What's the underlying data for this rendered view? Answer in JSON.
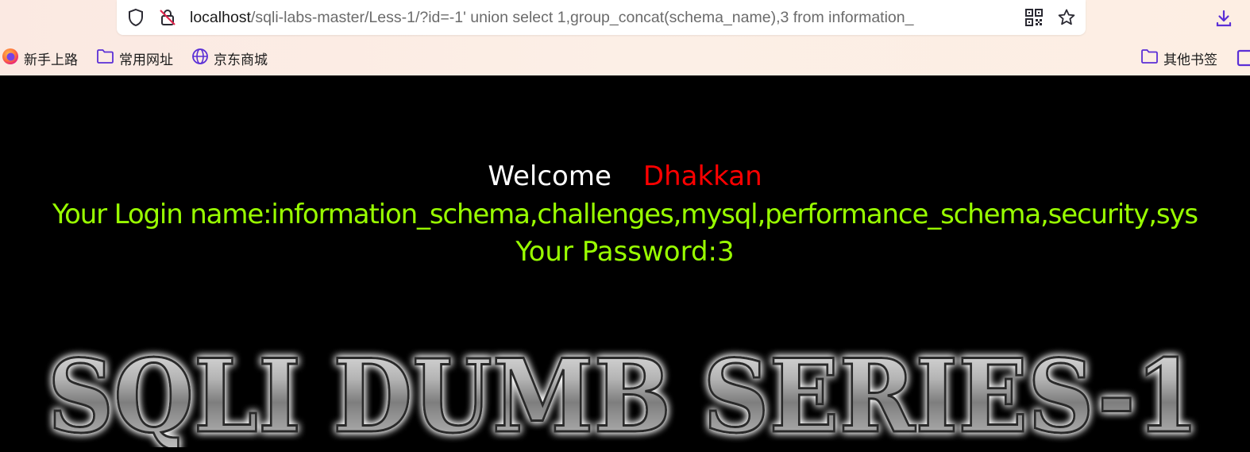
{
  "browser": {
    "url": {
      "host": "localhost",
      "path": "/sqli-labs-master/Less-1/?id=-1' union select 1,group_concat(schema_name),3 from information_"
    },
    "icons": {
      "shield": "shield-icon",
      "lock": "insecure-lock-icon",
      "qr": "qr-code-icon",
      "star": "bookmark-star-icon",
      "download": "download-icon"
    },
    "bookmarks": [
      {
        "label": "新手上路",
        "icon": "firefox-icon"
      },
      {
        "label": "常用网址",
        "icon": "folder-icon"
      },
      {
        "label": "京东商城",
        "icon": "globe-icon"
      }
    ],
    "other_bookmarks": {
      "label": "其他书签",
      "icon": "folder-icon"
    }
  },
  "page": {
    "welcome": "Welcome",
    "user_name": "Dhakkan",
    "login_line": "Your Login name:information_schema,challenges,mysql,performance_schema,security,sys",
    "password_line": "Your Password:3",
    "banner_text": "SQLI DUMB SERIES-1",
    "colors": {
      "background": "#000000",
      "welcome": "#ffffff",
      "user_name": "#ff0000",
      "result": "#99ff00"
    }
  }
}
